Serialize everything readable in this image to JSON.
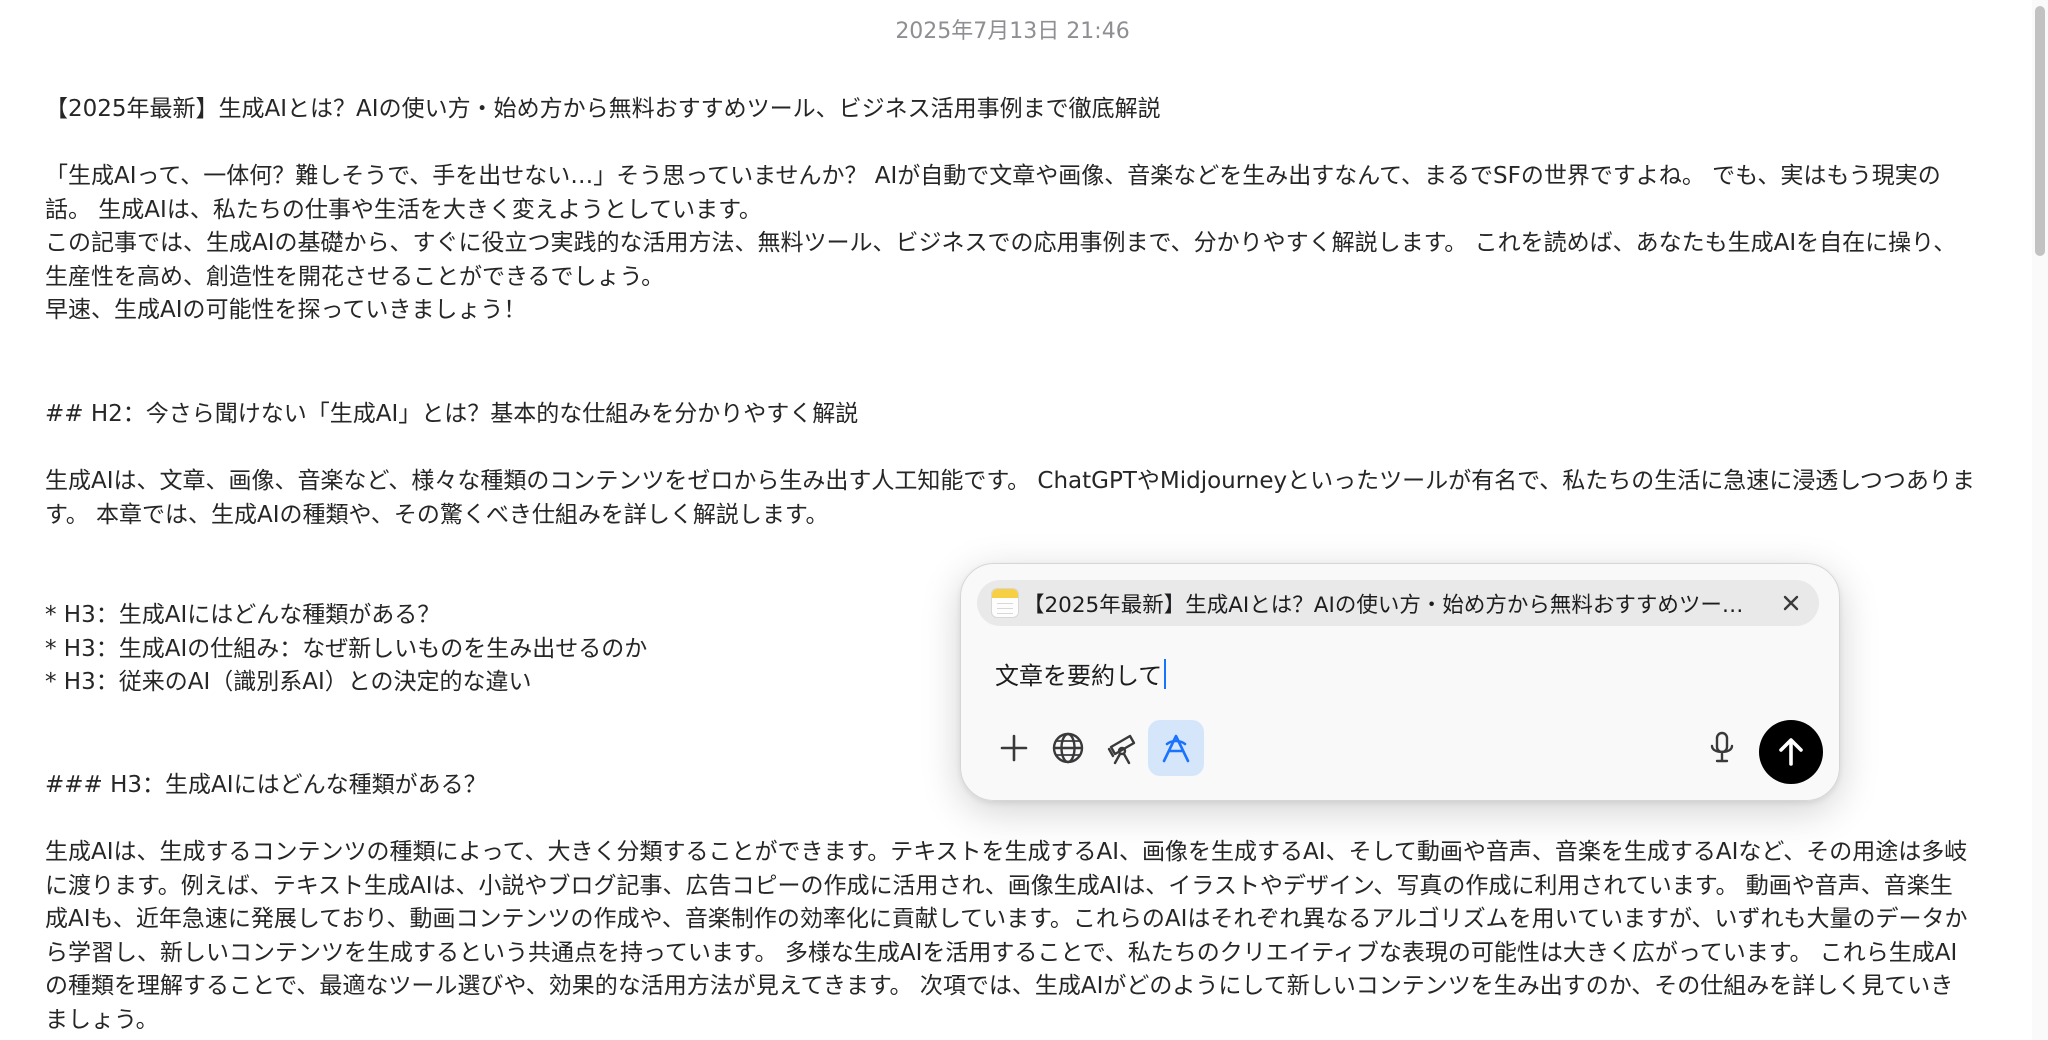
{
  "timestamp": "2025年7月13日 21:46",
  "document": {
    "lines": [
      "【2025年最新】生成AIとは？AIの使い方・始め方から無料おすすめツール、ビジネス活用事例まで徹底解説",
      "「生成AIって、一体何？難しそうで、手を出せない…」そう思っていませんか？ AIが自動で文章や画像、音楽などを生み出すなんて、まるでSFの世界ですよね。 でも、実はもう現実の話。 生成AIは、私たちの仕事や生活を大きく変えようとしています。\nこの記事では、生成AIの基礎から、すぐに役立つ実践的な活用方法、無料ツール、ビジネスでの応用事例まで、分かりやすく解説します。 これを読めば、あなたも生成AIを自在に操り、生産性を高め、創造性を開花させることができるでしょう。\n早速、生成AIの可能性を探っていきましょう！",
      "## H2：今さら聞けない「生成AI」とは？基本的な仕組みを分かりやすく解説",
      "生成AIは、文章、画像、音楽など、様々な種類のコンテンツをゼロから生み出す人工知能です。 ChatGPTやMidjourneyといったツールが有名で、私たちの生活に急速に浸透しつつあります。 本章では、生成AIの種類や、その驚くべき仕組みを詳しく解説します。",
      "* H3：生成AIにはどんな種類がある？\n* H3：生成AIの仕組み：なぜ新しいものを生み出せるのか\n* H3：従来のAI（識別系AI）との決定的な違い",
      "### H3：生成AIにはどんな種類がある？",
      "生成AIは、生成するコンテンツの種類によって、大きく分類することができます。テキストを生成するAI、画像を生成するAI、そして動画や音声、音楽を生成するAIなど、その用途は多岐に渡ります。例えば、テキスト生成AIは、小説やブログ記事、広告コピーの作成に活用され、画像生成AIは、イラストやデザイン、写真の作成に利用されています。 動画や音声、音楽生成AIも、近年急速に発展しており、動画コンテンツの作成や、音楽制作の効率化に貢献しています。これらのAIはそれぞれ異なるアルゴリズムを用いていますが、いずれも大量のデータから学習し、新しいコンテンツを生成するという共通点を持っています。 多様な生成AIを活用することで、私たちのクリエイティブな表現の可能性は大きく広がっています。 これら生成AIの種類を理解することで、最適なツール選びや、効果的な活用方法が見えてきます。 次項では、生成AIがどのようにして新しいコンテンツを生み出すのか、その仕組みを詳しく見ていきましょう。"
    ]
  },
  "assistant_panel": {
    "attachment_title": "【2025年最新】生成AIとは？AIの使い方・始め方から無料おすすめツー…",
    "prompt_value": "文章を要約して",
    "tools": {
      "add": "plus-icon",
      "web": "globe-icon",
      "research": "telescope-icon",
      "writing": "writing-tools-icon",
      "voice": "microphone-icon",
      "send": "arrow-up-icon"
    },
    "accent_color": "#1a73ff",
    "active_tool_bg": "#d5e6fb"
  }
}
